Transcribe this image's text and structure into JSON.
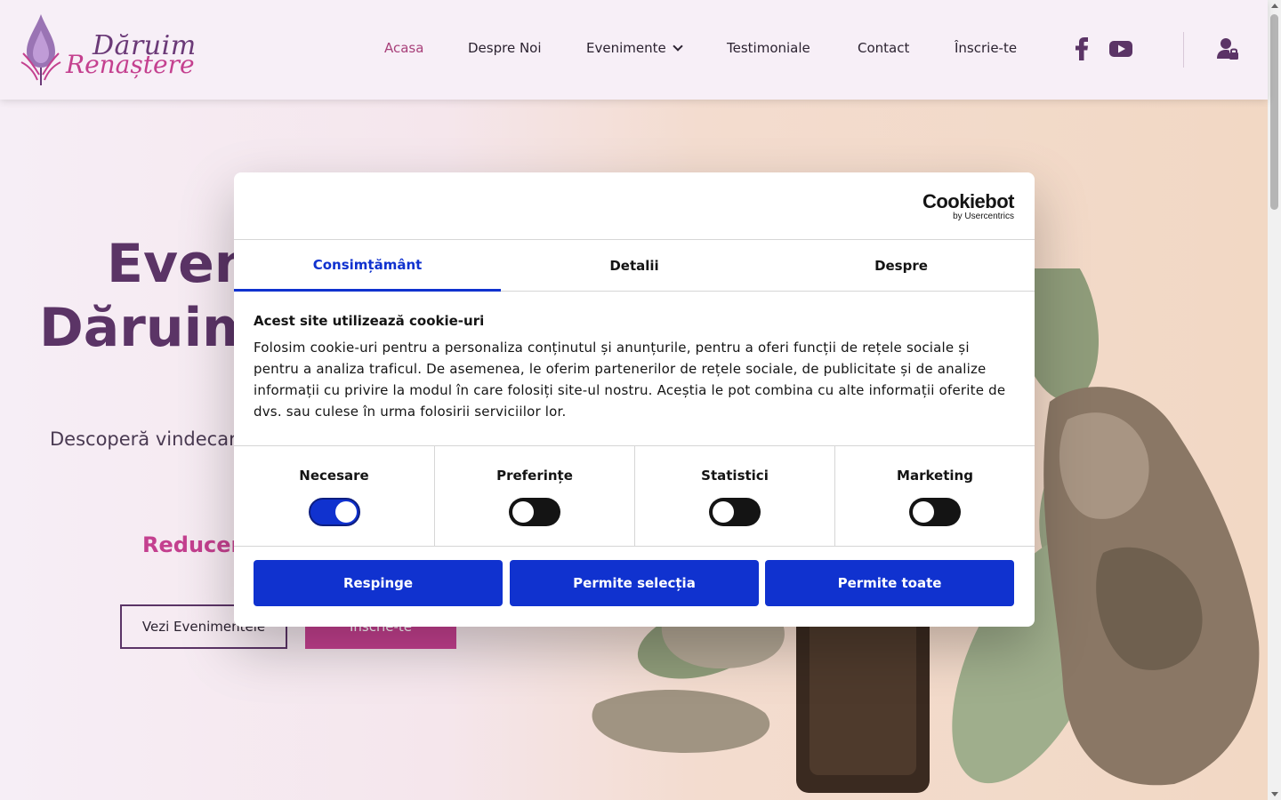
{
  "header": {
    "logo": {
      "line1": "Dăruim",
      "line2": "Renaștere"
    },
    "nav": [
      {
        "label": "Acasa",
        "active": true
      },
      {
        "label": "Despre Noi",
        "active": false
      },
      {
        "label": "Evenimente",
        "active": false,
        "has_dropdown": true
      },
      {
        "label": "Testimoniale",
        "active": false
      },
      {
        "label": "Contact",
        "active": false
      },
      {
        "label": "Înscrie-te",
        "active": false
      }
    ],
    "social_icons": [
      "facebook-icon",
      "youtube-icon"
    ],
    "account_icon": "user-lock-icon"
  },
  "hero": {
    "title_line1": "Even",
    "title_line2": "Dăruim",
    "subtitle": "Descoperă vindecare",
    "promo": "Reducer",
    "button_outline": "Vezi Evenimentele",
    "button_primary": "Înscrie-te"
  },
  "cookie_dialog": {
    "brand": {
      "name": "Cookiebot",
      "sub": "by Usercentrics"
    },
    "tabs": [
      {
        "label": "Consimțământ",
        "active": true
      },
      {
        "label": "Detalii",
        "active": false
      },
      {
        "label": "Despre",
        "active": false
      }
    ],
    "title": "Acest site utilizează cookie-uri",
    "text": "Folosim cookie-uri pentru a personaliza conținutul și anunțurile, pentru a oferi funcții de rețele sociale și pentru a analiza traficul. De asemenea, le oferim partenerilor de rețele sociale, de publicitate și de analize informații cu privire la modul în care folosiți site-ul nostru. Aceștia le pot combina cu alte informații oferite de dvs. sau culese în urma folosirii serviciilor lor.",
    "toggles": [
      {
        "label": "Necesare",
        "on": true
      },
      {
        "label": "Preferințe",
        "on": false
      },
      {
        "label": "Statistici",
        "on": false
      },
      {
        "label": "Marketing",
        "on": false
      }
    ],
    "buttons": {
      "reject": "Respinge",
      "allow_selection": "Permite selecția",
      "allow_all": "Permite toate"
    }
  },
  "colors": {
    "brand_purple": "#5b3466",
    "brand_pink": "#c4408f",
    "cookiebot_blue": "#1032cf"
  }
}
